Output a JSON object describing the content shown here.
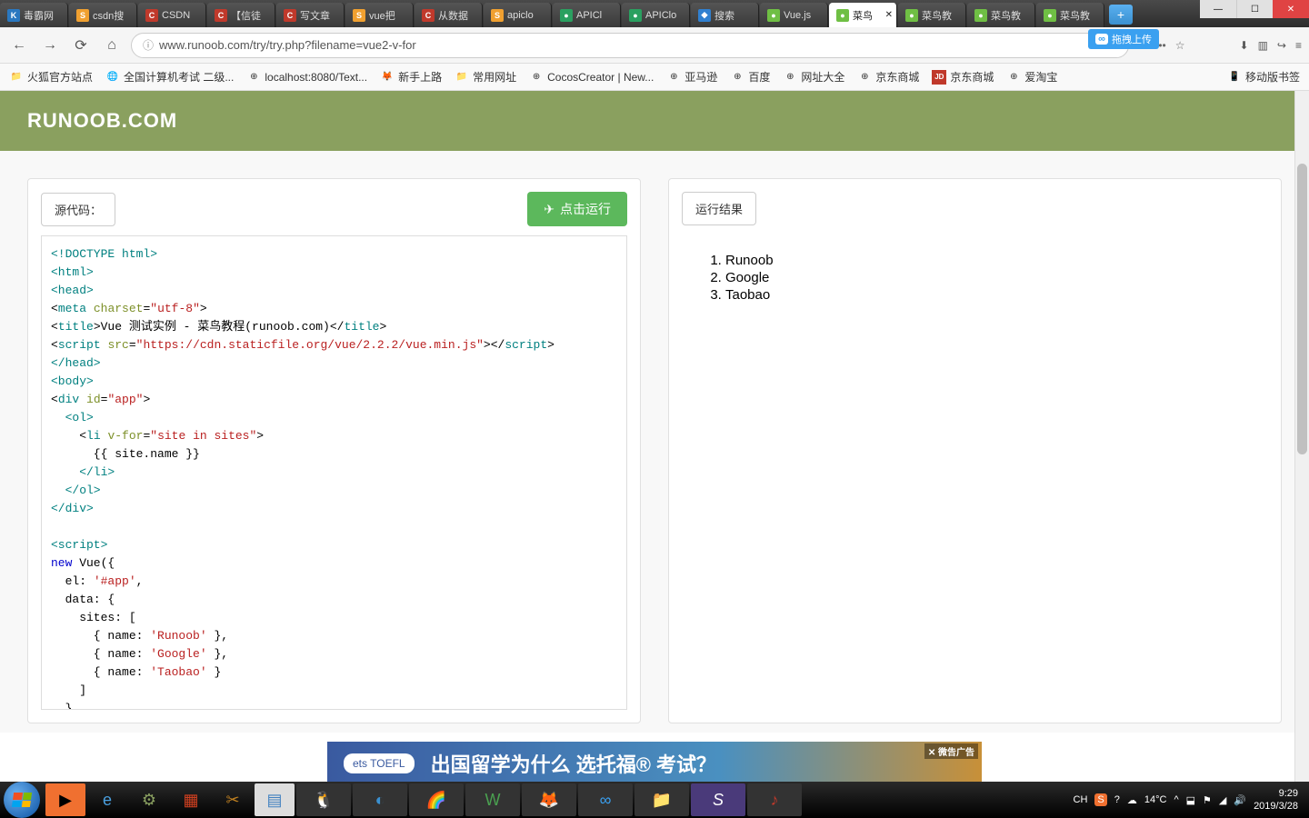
{
  "tabs": [
    {
      "label": "毒霸网",
      "icon": "K",
      "bg": "#2a78c0",
      "fg": "#fff"
    },
    {
      "label": "csdn搜",
      "icon": "S",
      "bg": "#f0a030",
      "fg": "#fff"
    },
    {
      "label": "CSDN",
      "icon": "C",
      "bg": "#c0392b",
      "fg": "#fff"
    },
    {
      "label": "【信徒",
      "icon": "C",
      "bg": "#c0392b",
      "fg": "#fff"
    },
    {
      "label": "写文章",
      "icon": "C",
      "bg": "#c0392b",
      "fg": "#fff"
    },
    {
      "label": "vue把",
      "icon": "S",
      "bg": "#f0a030",
      "fg": "#fff"
    },
    {
      "label": "从数据",
      "icon": "C",
      "bg": "#c0392b",
      "fg": "#fff"
    },
    {
      "label": "apiclo",
      "icon": "S",
      "bg": "#f0a030",
      "fg": "#fff"
    },
    {
      "label": "APICl",
      "icon": "●",
      "bg": "#2aa060",
      "fg": "#fff"
    },
    {
      "label": "APIClo",
      "icon": "●",
      "bg": "#2aa060",
      "fg": "#fff"
    },
    {
      "label": "搜索",
      "icon": "◆",
      "bg": "#3080d0",
      "fg": "#fff"
    },
    {
      "label": "Vue.js",
      "icon": "●",
      "bg": "#6fbf44",
      "fg": "#fff"
    },
    {
      "label": "菜鸟",
      "icon": "●",
      "bg": "#6fbf44",
      "fg": "#fff",
      "active": true
    },
    {
      "label": "菜鸟教",
      "icon": "●",
      "bg": "#6fbf44",
      "fg": "#fff"
    },
    {
      "label": "菜鸟教",
      "icon": "●",
      "bg": "#6fbf44",
      "fg": "#fff"
    },
    {
      "label": "菜鸟教",
      "icon": "●",
      "bg": "#6fbf44",
      "fg": "#fff"
    }
  ],
  "url": "www.runoob.com/try/try.php?filename=vue2-v-for",
  "ext_label": "拖拽上传",
  "bookmarks": [
    {
      "label": "火狐官方站点",
      "icon": "📁"
    },
    {
      "label": "全国计算机考试 二级...",
      "icon": "🌐"
    },
    {
      "label": "localhost:8080/Text...",
      "icon": "⊕"
    },
    {
      "label": "新手上路",
      "icon": "🦊"
    },
    {
      "label": "常用网址",
      "icon": "📁"
    },
    {
      "label": "CocosCreator | New...",
      "icon": "⊕"
    },
    {
      "label": "亚马逊",
      "icon": "⊕"
    },
    {
      "label": "百度",
      "icon": "⊕"
    },
    {
      "label": "网址大全",
      "icon": "⊕"
    },
    {
      "label": "京东商城",
      "icon": "⊕"
    },
    {
      "label": "京东商城",
      "icon": "JD",
      "jd": true
    },
    {
      "label": "爱淘宝",
      "icon": "⊕"
    }
  ],
  "bookmark_mobile": "移动版书签",
  "page_logo": "RUNOOB.COM",
  "source_label": "源代码：",
  "run_label": "点击运行",
  "result_label": "运行结果",
  "code_lines": [
    {
      "t": "<!DOCTYPE html>",
      "c": "tag"
    },
    {
      "t": "<html>",
      "c": "tag"
    },
    {
      "t": "<head>",
      "c": "tag"
    },
    {
      "html": "&lt;<span class='tag'>meta</span> <span class='attr'>charset</span>=<span class='str'>\"utf-8\"</span>&gt;"
    },
    {
      "html": "&lt;<span class='tag'>title</span>&gt;Vue 测试实例 - 菜鸟教程(runoob.com)&lt;/<span class='tag'>title</span>&gt;"
    },
    {
      "html": "&lt;<span class='tag'>script</span> <span class='attr'>src</span>=<span class='str'>\"https://cdn.staticfile.org/vue/2.2.2/vue.min.js\"</span>&gt;&lt;/<span class='tag'>script</span>&gt;"
    },
    {
      "t": "</head>",
      "c": "tag"
    },
    {
      "t": "<body>",
      "c": "tag"
    },
    {
      "html": "&lt;<span class='tag'>div</span> <span class='attr'>id</span>=<span class='str'>\"app\"</span>&gt;"
    },
    {
      "t": "  <ol>",
      "c": "tag"
    },
    {
      "html": "    &lt;<span class='tag'>li</span> <span class='attr'>v-for</span>=<span class='str'>\"site in sites\"</span>&gt;"
    },
    {
      "t": "      {{ site.name }}"
    },
    {
      "t": "    </li>",
      "c": "tag"
    },
    {
      "t": "  </ol>",
      "c": "tag"
    },
    {
      "t": "</div>",
      "c": "tag"
    },
    {
      "t": ""
    },
    {
      "t": "<script>",
      "c": "tag"
    },
    {
      "html": "<span class='kw'>new</span> Vue({"
    },
    {
      "html": "  el: <span class='str'>'#app'</span>,"
    },
    {
      "t": "  data: {"
    },
    {
      "t": "    sites: ["
    },
    {
      "html": "      { name: <span class='str'>'Runoob'</span> },"
    },
    {
      "html": "      { name: <span class='str'>'Google'</span> },"
    },
    {
      "html": "      { name: <span class='str'>'Taobao'</span> }"
    },
    {
      "t": "    ]"
    },
    {
      "t": "  }"
    }
  ],
  "result_items": [
    "Runoob",
    "Google",
    "Taobao"
  ],
  "ad": {
    "toefl": "ets TOEFL",
    "text": "出国留学为什么 选托福® 考试？",
    "close": "✕ 微告广告"
  },
  "tray": {
    "ime": "CH",
    "weather": "14°C",
    "time": "9:29",
    "date": "2019/3/28"
  }
}
